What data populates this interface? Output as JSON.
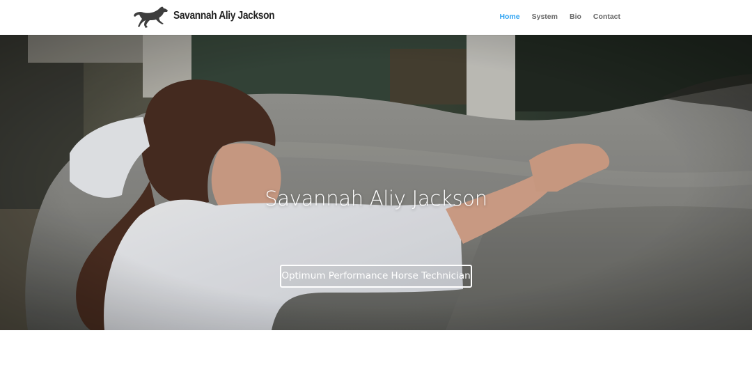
{
  "site": {
    "logo_text": "Savannah Aliy Jackson",
    "logo_icon": "running-horse-icon"
  },
  "nav": {
    "items": [
      {
        "label": "Home",
        "active": true
      },
      {
        "label": "System",
        "active": false
      },
      {
        "label": "Bio",
        "active": false
      },
      {
        "label": "Contact",
        "active": false
      }
    ]
  },
  "hero": {
    "title": "Savannah Aliy Jackson",
    "button_label": "Optimum Performance Horse Technician"
  },
  "colors": {
    "accent": "#2ea3f2",
    "nav_text": "#666666",
    "background": "#ffffff"
  }
}
